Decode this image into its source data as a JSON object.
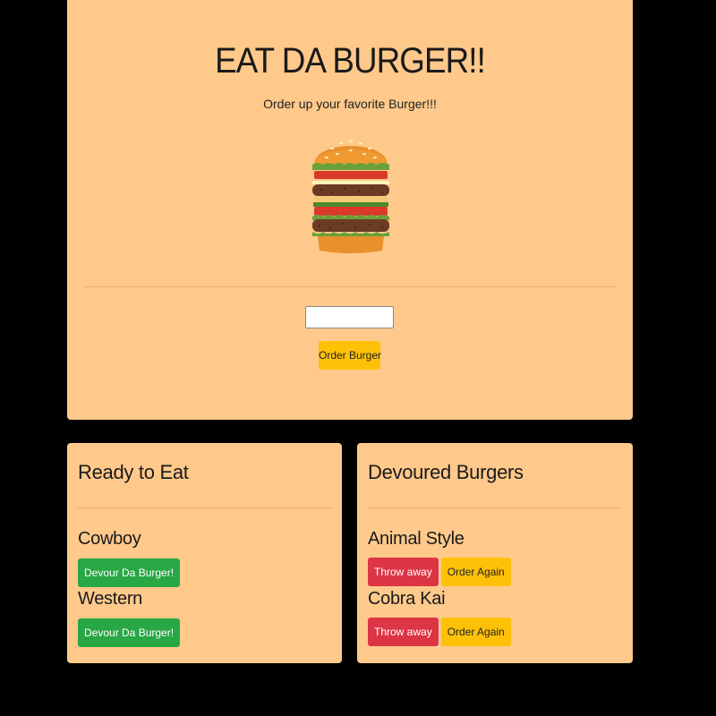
{
  "hero": {
    "title": "EAT DA BURGER!!",
    "subtitle": "Order up your favorite Burger!!!",
    "image_icon": "burger-illustration",
    "input_value": "",
    "input_placeholder": "",
    "order_button_label": "Order Burger"
  },
  "ready": {
    "title": "Ready to Eat",
    "items": [
      {
        "name": "Cowboy",
        "devour_label": "Devour Da Burger!"
      },
      {
        "name": "Western",
        "devour_label": "Devour Da Burger!"
      }
    ]
  },
  "devoured": {
    "title": "Devoured Burgers",
    "items": [
      {
        "name": "Animal Style",
        "throw_label": "Throw away",
        "order_again_label": "Order Again"
      },
      {
        "name": "Cobra Kai",
        "throw_label": "Throw away",
        "order_again_label": "Order Again"
      }
    ]
  },
  "colors": {
    "page_background": "#000000",
    "card_background": "#ffc98b",
    "warning": "#ffc107",
    "success": "#28a745",
    "danger": "#dc3545"
  }
}
